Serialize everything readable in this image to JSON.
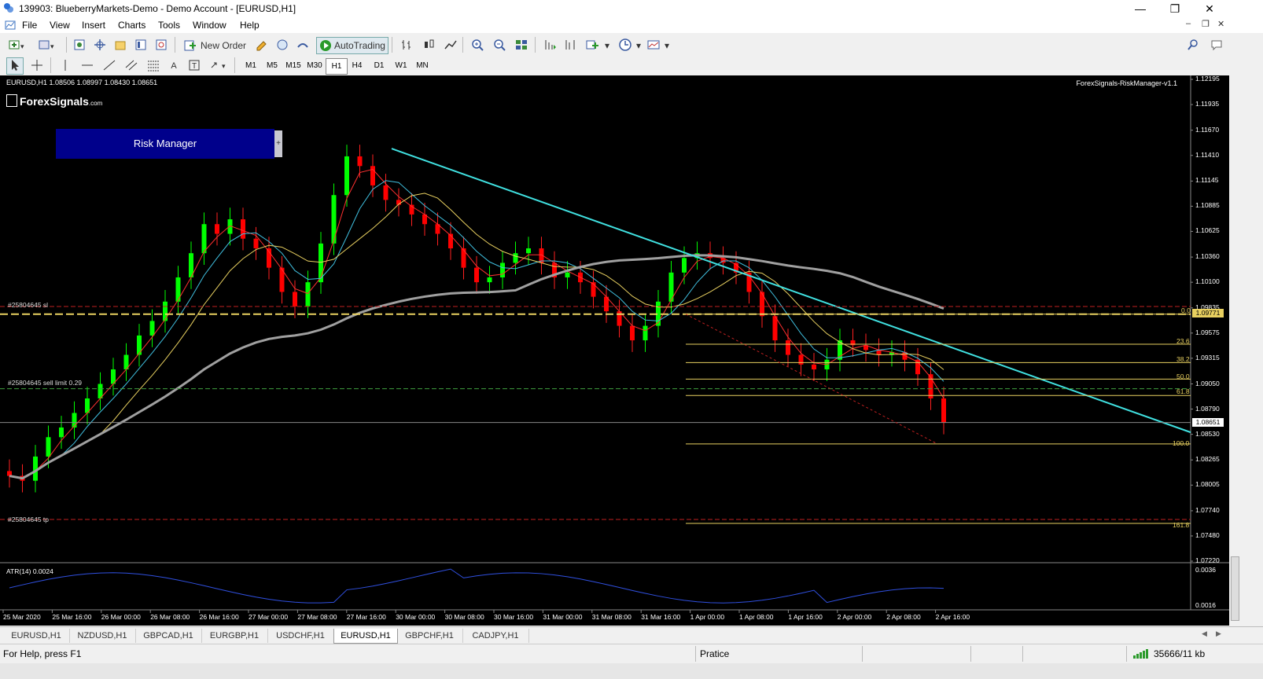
{
  "window": {
    "title": "139903: BlueberryMarkets-Demo - Demo Account - [EURUSD,H1]"
  },
  "menu": [
    "File",
    "View",
    "Insert",
    "Charts",
    "Tools",
    "Window",
    "Help"
  ],
  "toolbar": {
    "new_order": "New Order",
    "autotrading": "AutoTrading"
  },
  "timeframes": [
    "M1",
    "M5",
    "M15",
    "M30",
    "H1",
    "H4",
    "D1",
    "W1",
    "MN"
  ],
  "active_timeframe": "H1",
  "chart": {
    "symbol_info": "EURUSD,H1  1.08506 1.08997 1.08430 1.08651",
    "logo_main": "ForexSignals",
    "logo_suffix": ".com",
    "risk_manager": "Risk Manager",
    "risk_toggle": "+",
    "indicator_name": "ForexSignals-RiskManager-v1.1",
    "line_sl": "#25804645 sl",
    "line_sell_limit": "#25804645 sell limit 0.29",
    "line_tp": "#25804645 tp",
    "atr_label": "ATR(14) 0.0024",
    "price_labels": [
      "1.12195",
      "1.11935",
      "1.11670",
      "1.11410",
      "1.11145",
      "1.10885",
      "1.10625",
      "1.10360",
      "1.10100",
      "1.09835",
      "1.09575",
      "1.09315",
      "1.09050",
      "1.08790",
      "1.08530",
      "1.08265",
      "1.08005",
      "1.07740",
      "1.07480",
      "1.07220"
    ],
    "current_price": "1.08651",
    "sl_price": "1.09771",
    "atr_scale": [
      "0.0036",
      "0.0016"
    ],
    "fib_levels": [
      "0.0",
      "23.6",
      "38.2",
      "50.0",
      "61.8",
      "100.0",
      "161.8"
    ],
    "time_labels": [
      "25 Mar 2020",
      "25 Mar 16:00",
      "26 Mar 00:00",
      "26 Mar 08:00",
      "26 Mar 16:00",
      "27 Mar 00:00",
      "27 Mar 08:00",
      "27 Mar 16:00",
      "30 Mar 00:00",
      "30 Mar 08:00",
      "30 Mar 16:00",
      "31 Mar 00:00",
      "31 Mar 08:00",
      "31 Mar 16:00",
      "1 Apr 00:00",
      "1 Apr 08:00",
      "1 Apr 16:00",
      "2 Apr 00:00",
      "2 Apr 08:00",
      "2 Apr 16:00"
    ]
  },
  "chart_data": {
    "type": "candlestick",
    "symbol": "EURUSD",
    "timeframe": "H1",
    "ylim": [
      1.0722,
      1.12195
    ],
    "close": [
      1.081,
      1.0805,
      1.083,
      1.085,
      1.086,
      1.0875,
      1.089,
      1.0905,
      1.092,
      1.0935,
      1.0955,
      1.097,
      1.099,
      1.1015,
      1.104,
      1.107,
      1.106,
      1.1075,
      1.1055,
      1.1045,
      1.1025,
      1.1,
      1.0985,
      1.101,
      1.105,
      1.11,
      1.114,
      1.113,
      1.111,
      1.1095,
      1.109,
      1.108,
      1.107,
      1.106,
      1.1045,
      1.1025,
      1.101,
      1.1015,
      1.103,
      1.104,
      1.1045,
      1.103,
      1.1015,
      1.102,
      1.101,
      1.0995,
      1.098,
      1.0965,
      1.095,
      1.0965,
      1.099,
      1.102,
      1.1035,
      1.104,
      1.1035,
      1.103,
      1.102,
      1.1,
      1.0975,
      1.095,
      1.0935,
      1.0925,
      1.092,
      1.093,
      1.095,
      1.0945,
      1.094,
      1.0935,
      1.0938,
      1.093,
      1.0915,
      1.089,
      1.0865
    ],
    "atr_scale": [
      0.0016,
      0.0036
    ]
  },
  "tabs": [
    "EURUSD,H1",
    "NZDUSD,H1",
    "GBPCAD,H1",
    "EURGBP,H1",
    "USDCHF,H1",
    "EURUSD,H1",
    "GBPCHF,H1",
    "CADJPY,H1"
  ],
  "active_tab": 5,
  "status": {
    "help": "For Help, press F1",
    "profile": "Pratice",
    "connection": "35666/11 kb"
  }
}
